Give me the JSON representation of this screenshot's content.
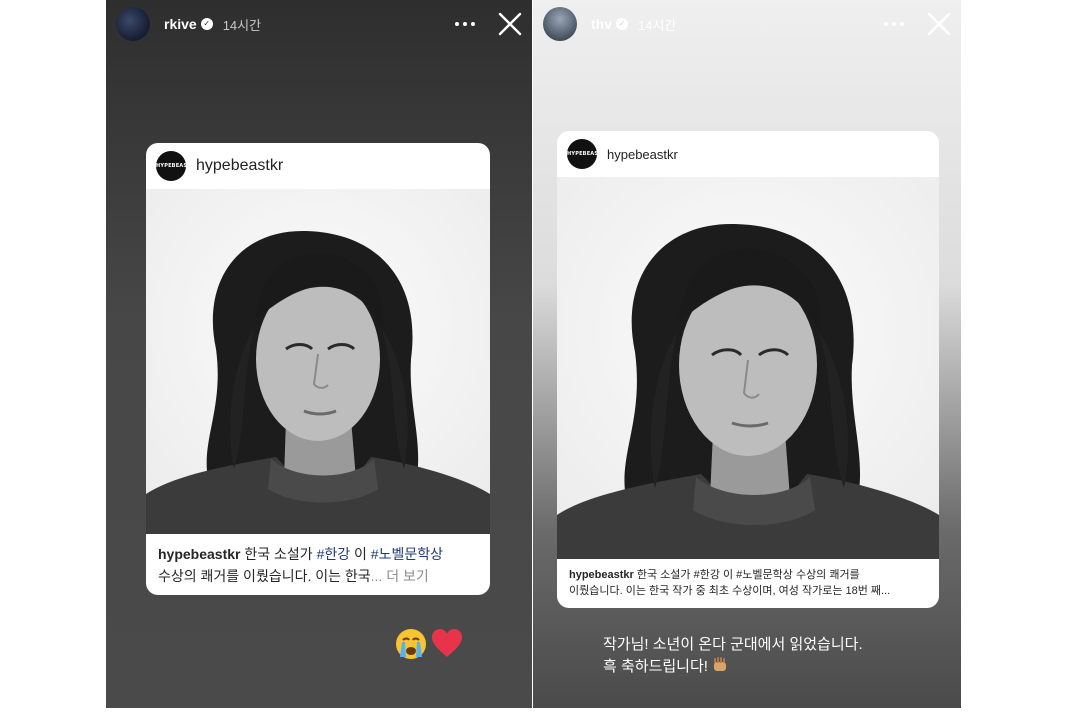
{
  "left_story": {
    "username": "rkive",
    "time": "14시간",
    "card": {
      "account_logo_text": "HYPEBEAST",
      "account": "hypebeastkr",
      "caption": {
        "user": "hypebeastkr",
        "part1": " 한국 소설가 ",
        "tag1": "#한강",
        "part2": " 이 ",
        "tag2": "#노벨문학상",
        "line2": "수상의 쾌거를 이뤘습니다. 이는 한국",
        "ellipsis": "...",
        "more": " 더 보기"
      }
    },
    "reactions": [
      "crying-face-icon",
      "red-heart-icon"
    ]
  },
  "right_story": {
    "username": "thv",
    "time": "14시간",
    "card": {
      "account_logo_text": "HYPEBEAST",
      "account": "hypebeastkr",
      "caption": {
        "user": "hypebeastkr",
        "line1_rest": " 한국 소설가 #한강 이 #노벨문학상 수상의 쾌거를",
        "line2": "이뤘습니다. 이는 한국 작가 중 최초 수상이며, 여성 작가로는 18번 째..."
      }
    },
    "reply": {
      "line1": "작가님! 소년이 온다 군대에서 읽었습니다.",
      "line2": "흑 축하드립니다!"
    }
  },
  "colors": {
    "hashtag": "#1f3b74",
    "heart": "#e8344a"
  }
}
